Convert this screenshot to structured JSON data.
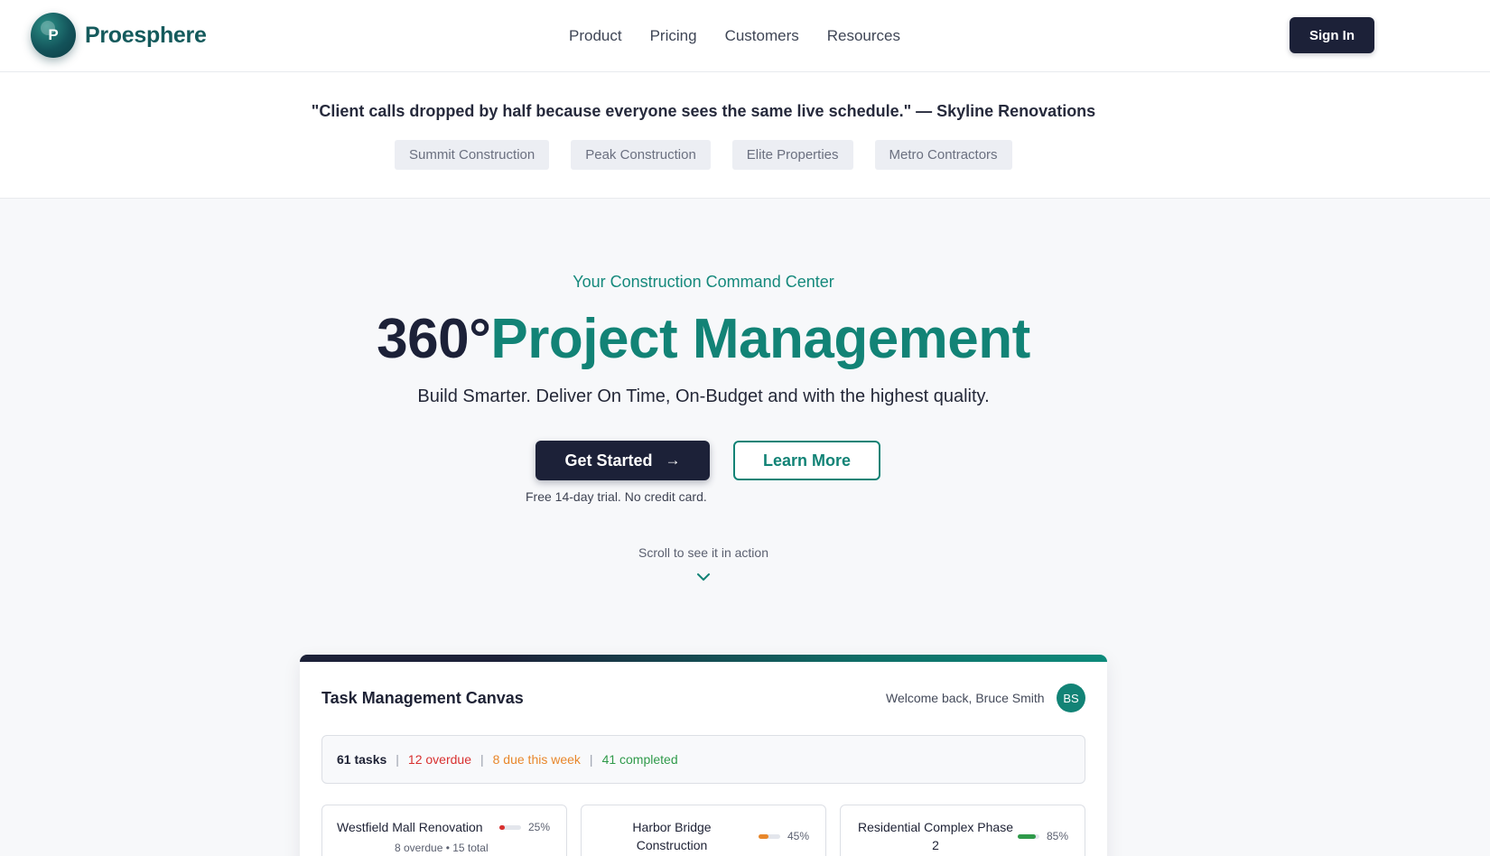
{
  "brand": {
    "name": "Proesphere",
    "logo_letter": "P"
  },
  "nav": {
    "items": [
      "Product",
      "Pricing",
      "Customers",
      "Resources"
    ]
  },
  "header": {
    "signin_label": "Sign In"
  },
  "testimonial": {
    "quote": "\"Client calls dropped by half because everyone sees the same live schedule.\" — Skyline Renovations",
    "logos": [
      "Summit Construction",
      "Peak Construction",
      "Elite Properties",
      "Metro Contractors"
    ]
  },
  "hero": {
    "eyebrow": "Your Construction Command Center",
    "title_dark": "360°",
    "title_teal": "Project Management",
    "subtitle": "Build Smarter. Deliver On Time, On-Budget and with the highest quality.",
    "cta_primary": "Get Started",
    "cta_secondary": "Learn More",
    "trial_note": "Free 14-day trial. No credit card.",
    "scroll_hint": "Scroll to see it in action"
  },
  "canvas": {
    "title": "Task Management Canvas",
    "welcome": "Welcome back, Bruce Smith",
    "avatar_initials": "BS",
    "stats": {
      "total": "61 tasks",
      "overdue": "12 overdue",
      "due_week": "8 due this week",
      "completed": "41 completed"
    },
    "projects": [
      {
        "name": "Westfield Mall Renovation",
        "progress_label": "25%",
        "progress": 0.25,
        "color": "#d8302f",
        "meta": "8 overdue • 15 total"
      },
      {
        "name": "Harbor Bridge Construction",
        "progress_label": "45%",
        "progress": 0.45,
        "color": "#e8872b"
      },
      {
        "name": "Residential Complex Phase 2",
        "progress_label": "85%",
        "progress": 0.85,
        "color": "#2f9a4a"
      }
    ]
  },
  "colors": {
    "brand_dark": "#1c2138",
    "brand_teal": "#128376",
    "overdue": "#d8302f",
    "due": "#e8872b",
    "completed": "#2f9a4a"
  }
}
